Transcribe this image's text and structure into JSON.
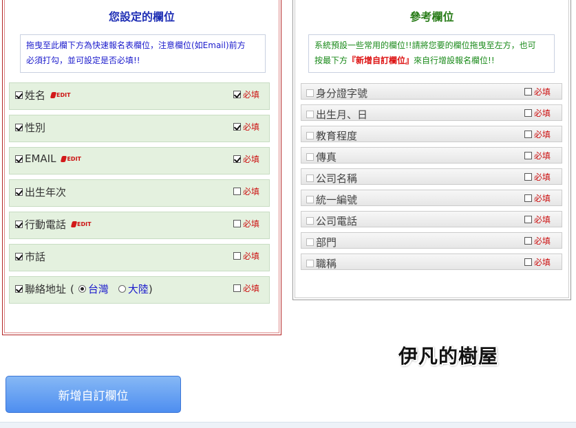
{
  "left_panel": {
    "title": "您設定的欄位",
    "notice_line1": "拖曳至此欄下方為快速報名表欄位，注意欄位(如Email)前方",
    "notice_line2": "必須打勾，並可設定是否必填!!",
    "fields": [
      {
        "label": "姓名",
        "checked": true,
        "editable": true,
        "required": true
      },
      {
        "label": "性別",
        "checked": true,
        "editable": false,
        "required": true
      },
      {
        "label": "EMAIL",
        "checked": true,
        "editable": true,
        "required": true
      },
      {
        "label": "出生年次",
        "checked": true,
        "editable": false,
        "required": false
      },
      {
        "label": "行動電話",
        "checked": true,
        "editable": true,
        "required": false
      },
      {
        "label": "市話",
        "checked": true,
        "editable": false,
        "required": false
      }
    ],
    "address": {
      "label": "聯絡地址",
      "open_paren": "(",
      "close_paren": ")",
      "option_tw": "台灣",
      "option_cn": "大陸",
      "selected": "台灣",
      "checked": true,
      "required": false
    },
    "edit_label": "EDIT",
    "required_label": "必填"
  },
  "right_panel": {
    "title": "參考欄位",
    "notice_part1": "系統預設一些常用的欄位!!請將您要的欄位拖曳至左方，也可",
    "notice_part2": "按最下方",
    "notice_highlight": "『新增自訂欄位』",
    "notice_part3": "來自行增設報名欄位!!",
    "fields": [
      "身分證字號",
      "出生月、日",
      "教育程度",
      "傳真",
      "公司名稱",
      "統一編號",
      "公司電話",
      "部門",
      "職稱"
    ],
    "required_label": "必填"
  },
  "watermark": "伊凡的樹屋",
  "add_button": "新增自訂欄位",
  "colors": {
    "left_title": "#1f2fb5",
    "right_title": "#2a7d1a",
    "required_text": "#cc1111",
    "field_bg": "#e4f1df",
    "button": "#4e8ef0"
  }
}
